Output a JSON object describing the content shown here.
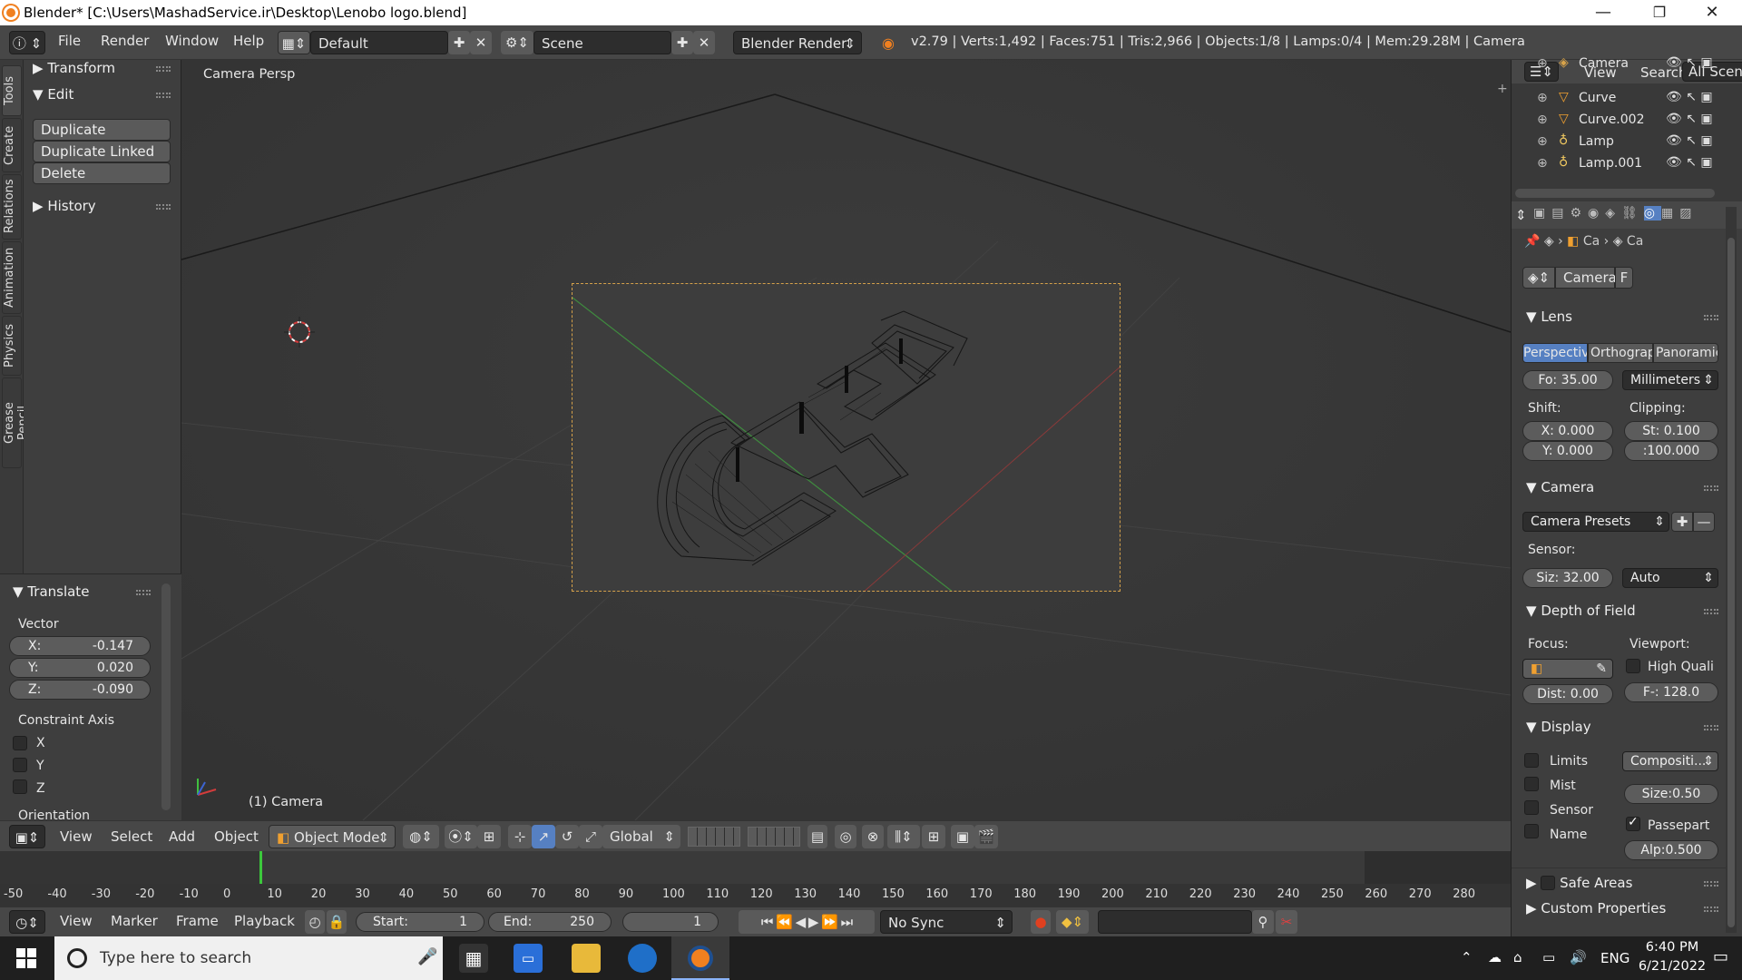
{
  "window": {
    "title": "Blender* [C:\\Users\\MashadService.ir\\Desktop\\Lenobo logo.blend]",
    "minimize": "—",
    "maximize": "❐",
    "close": "✕"
  },
  "info_header": {
    "menus": [
      "File",
      "Render",
      "Window",
      "Help"
    ],
    "layout": "Default",
    "scene": "Scene",
    "engine": "Blender Render",
    "stats": "v2.79 | Verts:1,492 | Faces:751 | Tris:2,966 | Objects:1/8 | Lamps:0/4 | Mem:29.28M | Camera"
  },
  "tool_tabs": [
    "Tools",
    "Create",
    "Relations",
    "Animation",
    "Physics",
    "Grease Pencil"
  ],
  "tool_panel": {
    "transform": "Transform",
    "edit": "Edit",
    "buttons": [
      "Duplicate",
      "Duplicate Linked",
      "Delete"
    ],
    "history": "History",
    "translate": "Translate",
    "vector_label": "Vector",
    "x_label": "X:",
    "x_value": "-0.147",
    "y_label": "Y:",
    "y_value": "0.020",
    "z_label": "Z:",
    "z_value": "-0.090",
    "constraint_axis": "Constraint Axis",
    "axes": [
      "X",
      "Y",
      "Z"
    ],
    "orientation": "Orientation"
  },
  "viewport": {
    "view_name": "Camera Persp",
    "object_label": "(1) Camera"
  },
  "viewport_header": {
    "menus": [
      "View",
      "Select",
      "Add",
      "Object"
    ],
    "mode": "Object Mode",
    "orientation": "Global"
  },
  "timeline": {
    "ticks": [
      "-50",
      "-40",
      "-30",
      "-20",
      "-10",
      "0",
      "10",
      "20",
      "30",
      "40",
      "50",
      "60",
      "70",
      "80",
      "90",
      "100",
      "110",
      "120",
      "130",
      "140",
      "150",
      "160",
      "170",
      "180",
      "190",
      "200",
      "210",
      "220",
      "230",
      "240",
      "250",
      "260",
      "270",
      "280"
    ],
    "menus": [
      "View",
      "Marker",
      "Frame",
      "Playback"
    ],
    "start_label": "Start:",
    "start_value": "1",
    "end_label": "End:",
    "end_value": "250",
    "current_frame": "1",
    "sync": "No Sync"
  },
  "outliner": {
    "header_menus": [
      "View",
      "Search"
    ],
    "scenes_dropdown": "All Scenes",
    "items": [
      "Camera",
      "Curve",
      "Curve.002",
      "Lamp",
      "Lamp.001"
    ]
  },
  "properties": {
    "breadcrumb_1": "Ca",
    "breadcrumb_2": "Ca",
    "datablock": "Camera",
    "datablock_f": "F",
    "lens": {
      "title": "Lens",
      "types": [
        "Perspectiv",
        "Orthograp",
        "Panoramic"
      ],
      "focal": "Fo: 35.00",
      "unit": "Millimeters",
      "shift_label": "Shift:",
      "clipping_label": "Clipping:",
      "shift_x": "X:  0.000",
      "shift_y": "Y:  0.000",
      "clip_start": "St: 0.100",
      "clip_end": ":100.000"
    },
    "camera": {
      "title": "Camera",
      "presets": "Camera Presets",
      "sensor_label": "Sensor:",
      "size": "Siz: 32.00",
      "fit": "Auto"
    },
    "dof": {
      "title": "Depth of Field",
      "focus_label": "Focus:",
      "viewport_label": "Viewport:",
      "high_quality": "High Quali",
      "distance": "Dist: 0.00",
      "fstop": "F-: 128.0"
    },
    "display": {
      "title": "Display",
      "limits": "Limits",
      "mist": "Mist",
      "sensor": "Sensor",
      "name": "Name",
      "composition": "Compositi...",
      "size": "Size:0.50",
      "passepartout": "Passepart",
      "alpha": "Alp:0.500"
    },
    "safe_areas": "Safe Areas",
    "custom_properties": "Custom Properties"
  },
  "taskbar": {
    "search_placeholder": "Type here to search",
    "language": "ENG",
    "time": "6:40 PM",
    "date": "6/21/2022"
  },
  "colors": {
    "accent": "#5680c2",
    "camera_frame": "#d4a04a",
    "playhead": "#3cc83c"
  }
}
